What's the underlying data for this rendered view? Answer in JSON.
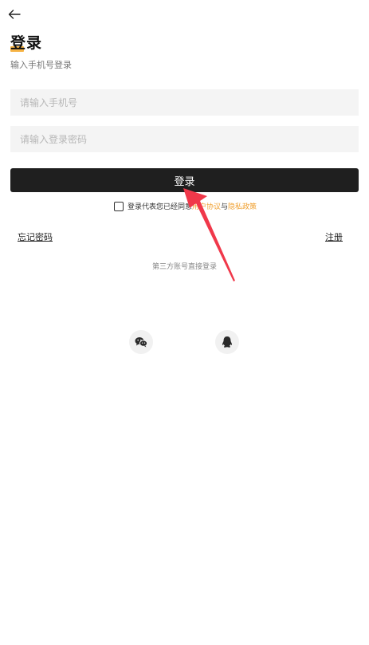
{
  "header": {
    "back_icon": "arrow-left-icon",
    "title": "登录",
    "subtitle": "输入手机号登录"
  },
  "form": {
    "phone_placeholder": "请输入手机号",
    "phone_value": "",
    "password_placeholder": "请输入登录密码",
    "password_value": "",
    "login_label": "登录"
  },
  "agreement": {
    "checked": false,
    "prefix": "登录代表您已经同意",
    "user_agreement": "用户协议",
    "joiner": "与",
    "privacy_policy": "隐私政策"
  },
  "links": {
    "forgot_password": "忘记密码",
    "register": "注册"
  },
  "third_party": {
    "label": "第三方账号直接登录",
    "providers": [
      {
        "name": "wechat",
        "icon": "wechat-icon"
      },
      {
        "name": "qq",
        "icon": "qq-icon"
      }
    ]
  },
  "colors": {
    "accent": "#f5a623",
    "link": "#f0a030",
    "button_bg": "#1f1f1f",
    "input_bg": "#f4f4f4",
    "annotation_arrow": "#f0384a"
  }
}
